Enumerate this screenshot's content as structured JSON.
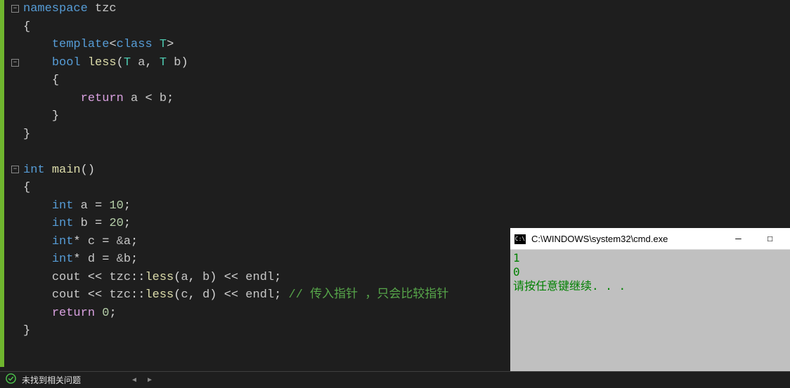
{
  "code": {
    "lines": [
      {
        "indent": 0,
        "tokens": [
          {
            "t": "kw-blue",
            "v": "namespace"
          },
          {
            "t": "plain",
            "v": " "
          },
          {
            "t": "var-gray",
            "v": "tzc"
          }
        ]
      },
      {
        "indent": 0,
        "tokens": [
          {
            "t": "punct",
            "v": "{"
          }
        ]
      },
      {
        "indent": 1,
        "tokens": [
          {
            "t": "kw-blue",
            "v": "template"
          },
          {
            "t": "punct",
            "v": "<"
          },
          {
            "t": "kw-blue",
            "v": "class"
          },
          {
            "t": "plain",
            "v": " "
          },
          {
            "t": "cls-teal",
            "v": "T"
          },
          {
            "t": "punct",
            "v": ">"
          }
        ]
      },
      {
        "indent": 1,
        "tokens": [
          {
            "t": "kw-blue",
            "v": "bool"
          },
          {
            "t": "plain",
            "v": " "
          },
          {
            "t": "fn-yellow",
            "v": "less"
          },
          {
            "t": "punct",
            "v": "("
          },
          {
            "t": "cls-teal",
            "v": "T"
          },
          {
            "t": "plain",
            "v": " "
          },
          {
            "t": "var-gray",
            "v": "a"
          },
          {
            "t": "punct",
            "v": ", "
          },
          {
            "t": "cls-teal",
            "v": "T"
          },
          {
            "t": "plain",
            "v": " "
          },
          {
            "t": "var-gray",
            "v": "b"
          },
          {
            "t": "punct",
            "v": ")"
          }
        ]
      },
      {
        "indent": 1,
        "tokens": [
          {
            "t": "punct",
            "v": "{"
          }
        ]
      },
      {
        "indent": 2,
        "tokens": [
          {
            "t": "pink",
            "v": "return"
          },
          {
            "t": "plain",
            "v": " "
          },
          {
            "t": "var-gray",
            "v": "a"
          },
          {
            "t": "plain",
            "v": " "
          },
          {
            "t": "punct",
            "v": "<"
          },
          {
            "t": "plain",
            "v": " "
          },
          {
            "t": "var-gray",
            "v": "b"
          },
          {
            "t": "punct",
            "v": ";"
          }
        ]
      },
      {
        "indent": 1,
        "tokens": [
          {
            "t": "punct",
            "v": "}"
          }
        ]
      },
      {
        "indent": 0,
        "tokens": [
          {
            "t": "punct",
            "v": "}"
          }
        ]
      },
      {
        "indent": 0,
        "tokens": []
      },
      {
        "indent": 0,
        "tokens": [
          {
            "t": "kw-blue",
            "v": "int"
          },
          {
            "t": "plain",
            "v": " "
          },
          {
            "t": "fn-yellow",
            "v": "main"
          },
          {
            "t": "punct",
            "v": "()"
          }
        ]
      },
      {
        "indent": 0,
        "tokens": [
          {
            "t": "punct",
            "v": "{"
          }
        ]
      },
      {
        "indent": 1,
        "tokens": [
          {
            "t": "kw-blue",
            "v": "int"
          },
          {
            "t": "plain",
            "v": " "
          },
          {
            "t": "var-gray",
            "v": "a"
          },
          {
            "t": "plain",
            "v": " "
          },
          {
            "t": "punct",
            "v": "="
          },
          {
            "t": "plain",
            "v": " "
          },
          {
            "t": "num-green",
            "v": "10"
          },
          {
            "t": "punct",
            "v": ";"
          }
        ]
      },
      {
        "indent": 1,
        "tokens": [
          {
            "t": "kw-blue",
            "v": "int"
          },
          {
            "t": "plain",
            "v": " "
          },
          {
            "t": "var-gray",
            "v": "b"
          },
          {
            "t": "plain",
            "v": " "
          },
          {
            "t": "punct",
            "v": "="
          },
          {
            "t": "plain",
            "v": " "
          },
          {
            "t": "num-green",
            "v": "20"
          },
          {
            "t": "punct",
            "v": ";"
          }
        ]
      },
      {
        "indent": 1,
        "tokens": [
          {
            "t": "kw-blue",
            "v": "int"
          },
          {
            "t": "punct",
            "v": "*"
          },
          {
            "t": "plain",
            "v": " "
          },
          {
            "t": "var-gray",
            "v": "c"
          },
          {
            "t": "plain",
            "v": " "
          },
          {
            "t": "punct",
            "v": "="
          },
          {
            "t": "plain",
            "v": " "
          },
          {
            "t": "op-gray",
            "v": "&"
          },
          {
            "t": "var-gray",
            "v": "a"
          },
          {
            "t": "punct",
            "v": ";"
          }
        ]
      },
      {
        "indent": 1,
        "tokens": [
          {
            "t": "kw-blue",
            "v": "int"
          },
          {
            "t": "punct",
            "v": "*"
          },
          {
            "t": "plain",
            "v": " "
          },
          {
            "t": "var-gray",
            "v": "d"
          },
          {
            "t": "plain",
            "v": " "
          },
          {
            "t": "punct",
            "v": "="
          },
          {
            "t": "plain",
            "v": " "
          },
          {
            "t": "op-gray",
            "v": "&"
          },
          {
            "t": "var-gray",
            "v": "b"
          },
          {
            "t": "punct",
            "v": ";"
          }
        ]
      },
      {
        "indent": 1,
        "tokens": [
          {
            "t": "var-gray",
            "v": "cout"
          },
          {
            "t": "plain",
            "v": " "
          },
          {
            "t": "punct",
            "v": "<<"
          },
          {
            "t": "plain",
            "v": " "
          },
          {
            "t": "var-gray",
            "v": "tzc"
          },
          {
            "t": "punct",
            "v": "::"
          },
          {
            "t": "fn-yellow",
            "v": "less"
          },
          {
            "t": "punct",
            "v": "("
          },
          {
            "t": "var-gray",
            "v": "a"
          },
          {
            "t": "punct",
            "v": ", "
          },
          {
            "t": "var-gray",
            "v": "b"
          },
          {
            "t": "punct",
            "v": ")"
          },
          {
            "t": "plain",
            "v": " "
          },
          {
            "t": "punct",
            "v": "<<"
          },
          {
            "t": "plain",
            "v": " "
          },
          {
            "t": "var-gray",
            "v": "endl"
          },
          {
            "t": "punct",
            "v": ";"
          }
        ]
      },
      {
        "indent": 1,
        "tokens": [
          {
            "t": "var-gray",
            "v": "cout"
          },
          {
            "t": "plain",
            "v": " "
          },
          {
            "t": "punct",
            "v": "<<"
          },
          {
            "t": "plain",
            "v": " "
          },
          {
            "t": "var-gray",
            "v": "tzc"
          },
          {
            "t": "punct",
            "v": "::"
          },
          {
            "t": "fn-yellow",
            "v": "less"
          },
          {
            "t": "punct",
            "v": "("
          },
          {
            "t": "var-gray",
            "v": "c"
          },
          {
            "t": "punct",
            "v": ", "
          },
          {
            "t": "var-gray",
            "v": "d"
          },
          {
            "t": "punct",
            "v": ")"
          },
          {
            "t": "plain",
            "v": " "
          },
          {
            "t": "punct",
            "v": "<<"
          },
          {
            "t": "plain",
            "v": " "
          },
          {
            "t": "var-gray",
            "v": "endl"
          },
          {
            "t": "punct",
            "v": "; "
          },
          {
            "t": "comment",
            "v": "// 传入指针 ，只会比较指针"
          }
        ]
      },
      {
        "indent": 1,
        "tokens": [
          {
            "t": "pink",
            "v": "return"
          },
          {
            "t": "plain",
            "v": " "
          },
          {
            "t": "num-green",
            "v": "0"
          },
          {
            "t": "punct",
            "v": ";"
          }
        ]
      },
      {
        "indent": 0,
        "tokens": [
          {
            "t": "punct",
            "v": "}"
          }
        ]
      }
    ]
  },
  "console": {
    "title": "C:\\WINDOWS\\system32\\cmd.exe",
    "icon_label": "C:\\",
    "output": [
      "1",
      "0",
      "请按任意键继续. . ."
    ],
    "minimize": "—",
    "maximize": "☐"
  },
  "status": {
    "text": "未找到相关问题",
    "arrow_left": "◀",
    "arrow_right": "▶"
  }
}
